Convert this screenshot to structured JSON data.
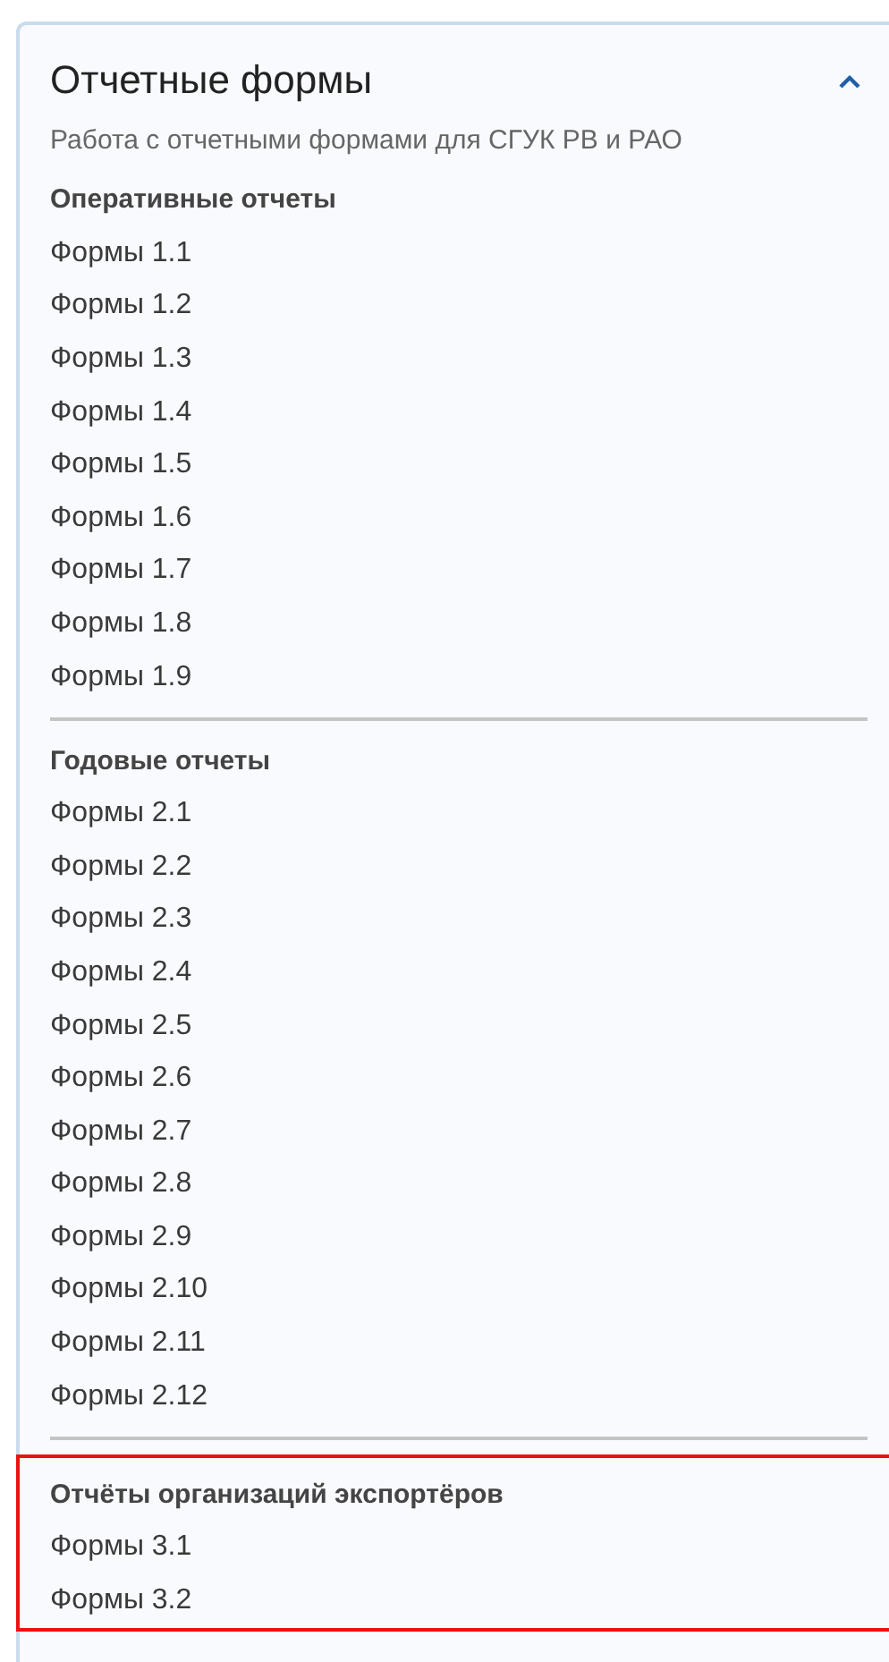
{
  "panel": {
    "title": "Отчетные формы",
    "expanded": true,
    "subtitle": "Работа с отчетными формами для СГУК РВ и РАО"
  },
  "sections": [
    {
      "title": "Оперативные отчеты",
      "highlighted": false,
      "items": [
        "Формы 1.1",
        "Формы 1.2",
        "Формы 1.3",
        "Формы 1.4",
        "Формы 1.5",
        "Формы 1.6",
        "Формы 1.7",
        "Формы 1.8",
        "Формы 1.9"
      ]
    },
    {
      "title": "Годовые отчеты",
      "highlighted": false,
      "items": [
        "Формы 2.1",
        "Формы 2.2",
        "Формы 2.3",
        "Формы 2.4",
        "Формы 2.5",
        "Формы 2.6",
        "Формы 2.7",
        "Формы 2.8",
        "Формы 2.9",
        "Формы 2.10",
        "Формы 2.11",
        "Формы 2.12"
      ]
    },
    {
      "title": "Отчёты организаций экспортёров",
      "highlighted": true,
      "items": [
        "Формы 3.1",
        "Формы 3.2"
      ]
    }
  ]
}
